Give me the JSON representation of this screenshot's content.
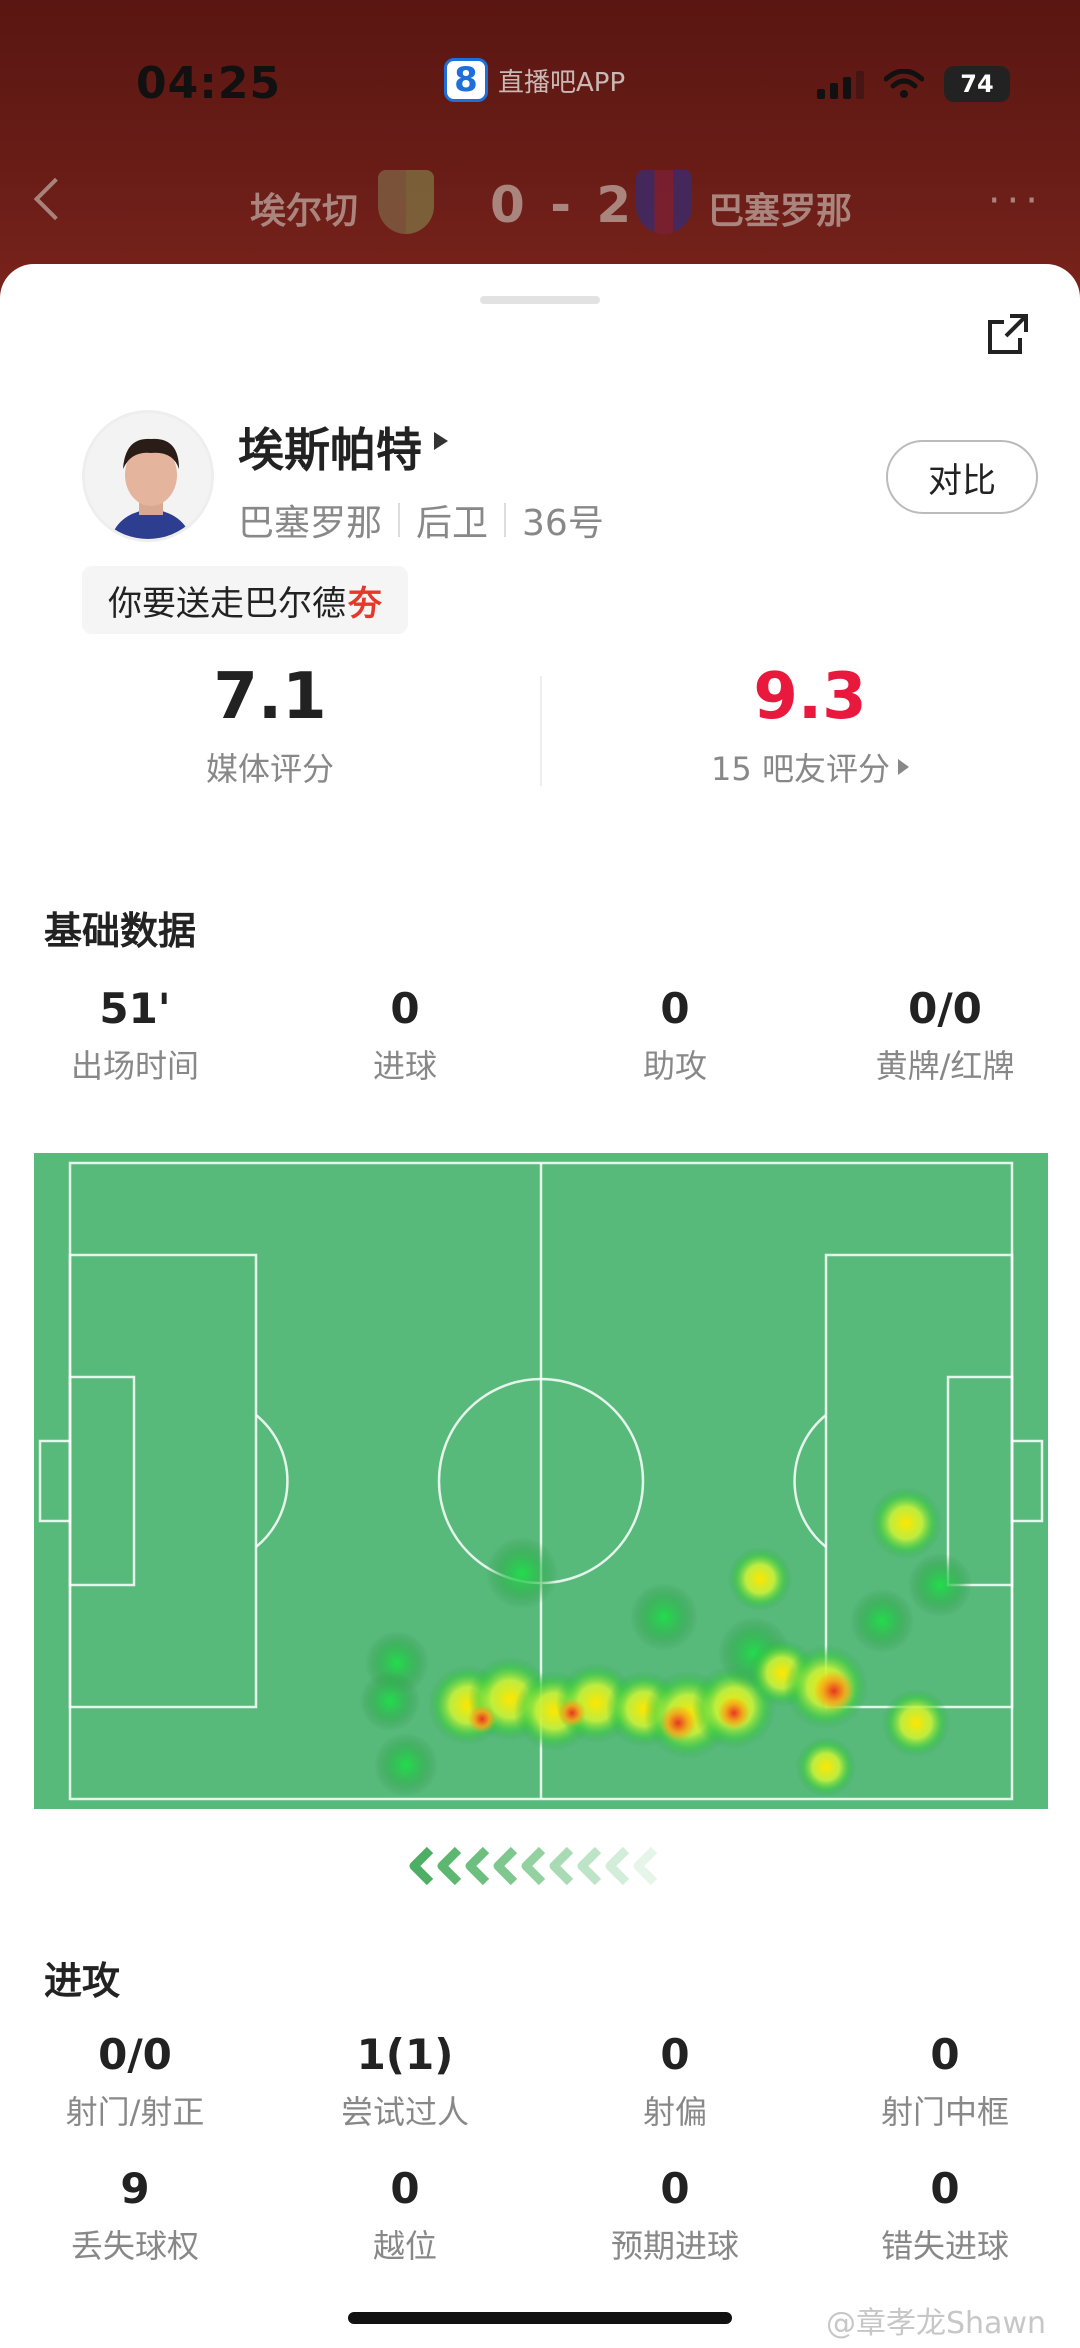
{
  "status_bar": {
    "time": "04:25",
    "app_logo": "8",
    "app_name": "直播吧APP",
    "battery": "74"
  },
  "match": {
    "home_team": "埃尔切",
    "score": "0 - 2",
    "away_team": "巴塞罗那",
    "more": "···"
  },
  "player": {
    "name": "埃斯帕特",
    "team": "巴塞罗那",
    "position": "后卫",
    "number": "36号",
    "compare_label": "对比",
    "tag_text": "你要送走巴尔德",
    "tag_accent": "夯"
  },
  "ratings": {
    "media": {
      "value": "7.1",
      "label": "媒体评分"
    },
    "fans": {
      "value": "9.3",
      "label": "15 吧友评分",
      "color": "#e8193c"
    }
  },
  "basic": {
    "title": "基础数据",
    "stats": [
      {
        "value": "51'",
        "label": "出场时间"
      },
      {
        "value": "0",
        "label": "进球"
      },
      {
        "value": "0",
        "label": "助攻"
      },
      {
        "value": "0/0",
        "label": "黄牌/红牌"
      }
    ]
  },
  "heatmap": {
    "pitch_color": "#57b97a",
    "line_color": "#ffffff"
  },
  "attack": {
    "title": "进攻",
    "row1": [
      {
        "value": "0/0",
        "label": "射门/射正"
      },
      {
        "value": "1(1)",
        "label": "尝试过人"
      },
      {
        "value": "0",
        "label": "射偏"
      },
      {
        "value": "0",
        "label": "射门中框"
      }
    ],
    "row2": [
      {
        "value": "9",
        "label": "丢失球权"
      },
      {
        "value": "0",
        "label": "越位"
      },
      {
        "value": "0",
        "label": "预期进球"
      },
      {
        "value": "0",
        "label": "错失进球"
      }
    ]
  },
  "watermark": "@章孝龙Shawn"
}
